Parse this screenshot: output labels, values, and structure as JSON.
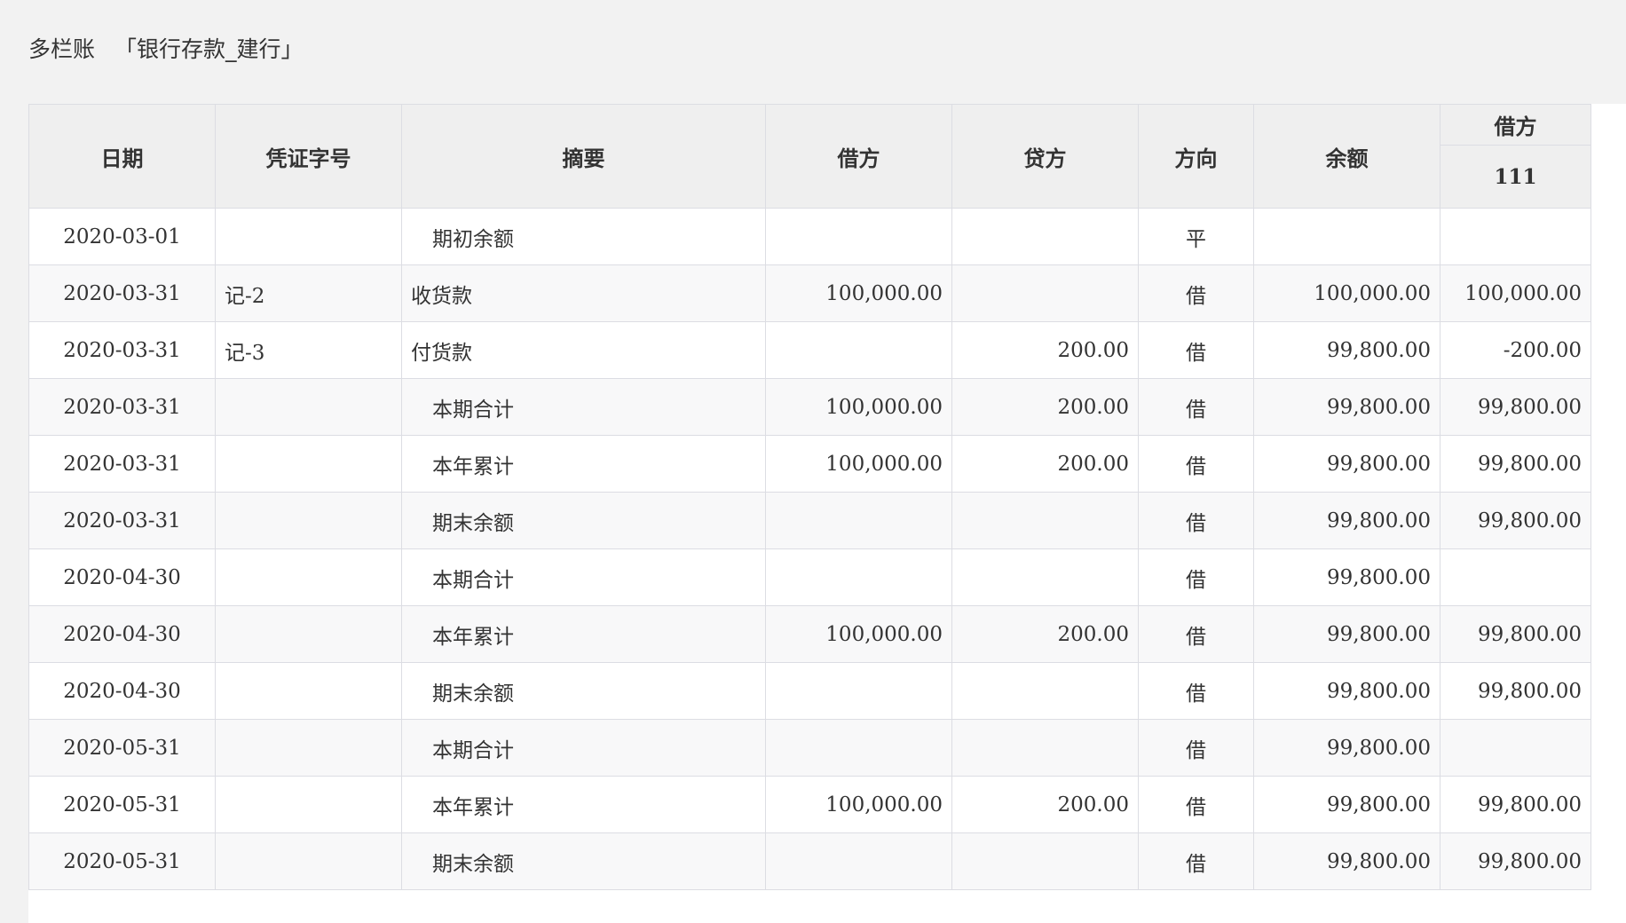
{
  "header": {
    "title": "多栏账",
    "account": "「银行存款_建行」"
  },
  "table": {
    "columns": {
      "date": "日期",
      "voucher": "凭证字号",
      "summary": "摘要",
      "debit": "借方",
      "credit": "贷方",
      "direction": "方向",
      "balance": "余额",
      "group": "借方",
      "group_sub": "111"
    },
    "rows": [
      {
        "date": "2020-03-01",
        "voucher": "",
        "summary": "期初余额",
        "indent": true,
        "debit": "",
        "credit": "",
        "direction": "平",
        "balance": "",
        "col111": ""
      },
      {
        "date": "2020-03-31",
        "voucher": "记-2",
        "summary": "收货款",
        "indent": false,
        "debit": "100,000.00",
        "credit": "",
        "direction": "借",
        "balance": "100,000.00",
        "col111": "100,000.00"
      },
      {
        "date": "2020-03-31",
        "voucher": "记-3",
        "summary": "付货款",
        "indent": false,
        "debit": "",
        "credit": "200.00",
        "direction": "借",
        "balance": "99,800.00",
        "col111": "-200.00"
      },
      {
        "date": "2020-03-31",
        "voucher": "",
        "summary": "本期合计",
        "indent": true,
        "debit": "100,000.00",
        "credit": "200.00",
        "direction": "借",
        "balance": "99,800.00",
        "col111": "99,800.00"
      },
      {
        "date": "2020-03-31",
        "voucher": "",
        "summary": "本年累计",
        "indent": true,
        "debit": "100,000.00",
        "credit": "200.00",
        "direction": "借",
        "balance": "99,800.00",
        "col111": "99,800.00"
      },
      {
        "date": "2020-03-31",
        "voucher": "",
        "summary": "期末余额",
        "indent": true,
        "debit": "",
        "credit": "",
        "direction": "借",
        "balance": "99,800.00",
        "col111": "99,800.00"
      },
      {
        "date": "2020-04-30",
        "voucher": "",
        "summary": "本期合计",
        "indent": true,
        "debit": "",
        "credit": "",
        "direction": "借",
        "balance": "99,800.00",
        "col111": ""
      },
      {
        "date": "2020-04-30",
        "voucher": "",
        "summary": "本年累计",
        "indent": true,
        "debit": "100,000.00",
        "credit": "200.00",
        "direction": "借",
        "balance": "99,800.00",
        "col111": "99,800.00"
      },
      {
        "date": "2020-04-30",
        "voucher": "",
        "summary": "期末余额",
        "indent": true,
        "debit": "",
        "credit": "",
        "direction": "借",
        "balance": "99,800.00",
        "col111": "99,800.00"
      },
      {
        "date": "2020-05-31",
        "voucher": "",
        "summary": "本期合计",
        "indent": true,
        "debit": "",
        "credit": "",
        "direction": "借",
        "balance": "99,800.00",
        "col111": ""
      },
      {
        "date": "2020-05-31",
        "voucher": "",
        "summary": "本年累计",
        "indent": true,
        "debit": "100,000.00",
        "credit": "200.00",
        "direction": "借",
        "balance": "99,800.00",
        "col111": "99,800.00"
      },
      {
        "date": "2020-05-31",
        "voucher": "",
        "summary": "期末余额",
        "indent": true,
        "debit": "",
        "credit": "",
        "direction": "借",
        "balance": "99,800.00",
        "col111": "99,800.00"
      }
    ]
  }
}
